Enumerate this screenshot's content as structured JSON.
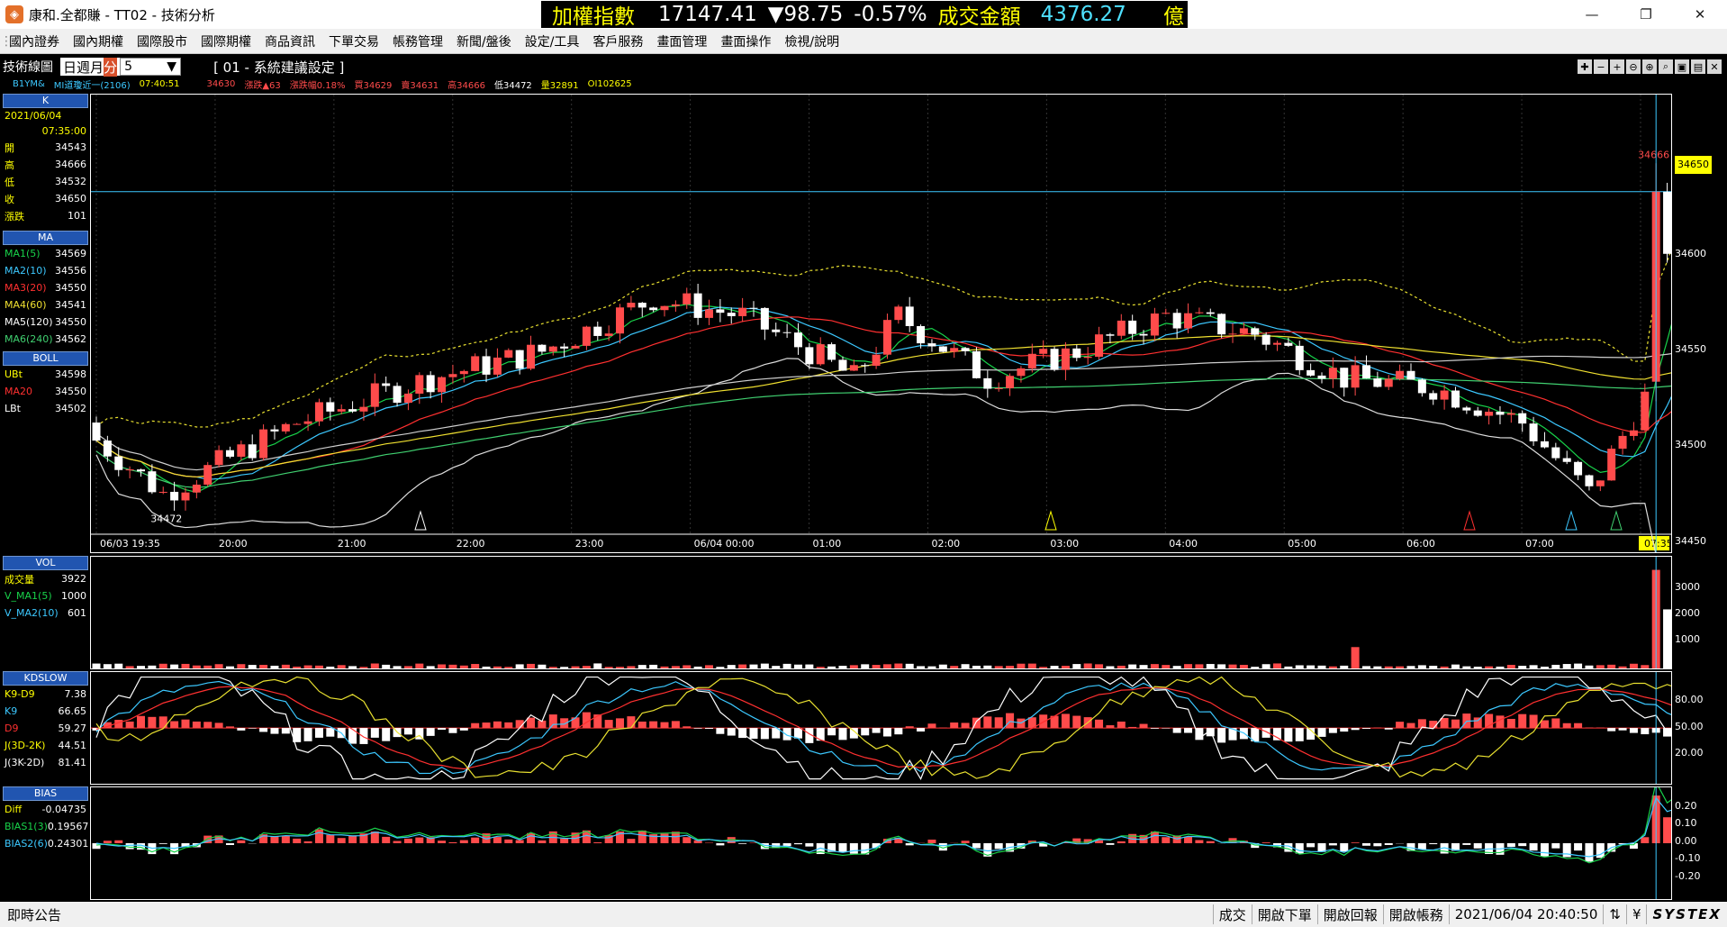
{
  "window": {
    "title": "康和.全都賺 - TT02 - 技術分析",
    "icon": "app-logo-icon",
    "buttons": [
      "—",
      "❐",
      "✕"
    ]
  },
  "ticker": {
    "label": "加權指數",
    "value": "17147.41",
    "change": "▼98.75",
    "pct": "-0.57%",
    "turnover_label": "成交金額",
    "turnover": "4376.27",
    "unit": "億"
  },
  "menu": [
    "國內證券",
    "國內期權",
    "國際股市",
    "國際期權",
    "商品資訊",
    "下單交易",
    "帳務管理",
    "新聞/盤後",
    "設定/工具",
    "客戶服務",
    "畫面管理",
    "畫面操作",
    "檢視/說明"
  ],
  "toolbar": {
    "panel_label": "技術線圖",
    "period": {
      "day": "日",
      "week": "週",
      "month": "月",
      "minute": "分"
    },
    "interval": "5",
    "setting": "[ 01 - 系統建議設定 ]"
  },
  "info": {
    "symbol": "B1YM&",
    "name": "MI道瓊近一(2106)",
    "time": "07:40:51",
    "last": "34630",
    "change": "漲跌▲63",
    "pct": "漲跌幅0.18%",
    "bid": "買34629",
    "ask": "賣34631",
    "high": "高34666",
    "low": "低34472",
    "vol": "量32891",
    "oi": "OI102625"
  },
  "k_panel": {
    "title": "K",
    "date": "2021/06/04",
    "time": "07:35:00",
    "rows": [
      {
        "label": "開",
        "value": "34543"
      },
      {
        "label": "高",
        "value": "34666"
      },
      {
        "label": "低",
        "value": "34532"
      },
      {
        "label": "收",
        "value": "34650"
      },
      {
        "label": "漲跌",
        "value": "101"
      }
    ]
  },
  "ma_panel": {
    "title": "MA",
    "rows": [
      {
        "label": "MA1(5)",
        "value": "34569"
      },
      {
        "label": "MA2(10)",
        "value": "34556"
      },
      {
        "label": "MA3(20)",
        "value": "34550"
      },
      {
        "label": "MA4(60)",
        "value": "34541"
      },
      {
        "label": "MA5(120)",
        "value": "34550"
      },
      {
        "label": "MA6(240)",
        "value": "34562"
      }
    ]
  },
  "boll_panel": {
    "title": "BOLL",
    "rows": [
      {
        "label": "UBt",
        "value": "34598"
      },
      {
        "label": "MA20",
        "value": "34550"
      },
      {
        "label": "LBt",
        "value": "34502"
      }
    ]
  },
  "vol_panel": {
    "title": "VOL",
    "rows": [
      {
        "label": "成交量",
        "value": "3922"
      },
      {
        "label": "V_MA1(5)",
        "value": "1000"
      },
      {
        "label": "V_MA2(10)",
        "value": "601"
      }
    ]
  },
  "kd_panel": {
    "title": "KDSLOW",
    "rows": [
      {
        "label": "K9-D9",
        "value": "7.38"
      },
      {
        "label": "K9",
        "value": "66.65"
      },
      {
        "label": "D9",
        "value": "59.27"
      },
      {
        "label": "J(3D-2K)",
        "value": "44.51"
      },
      {
        "label": "J(3K-2D)",
        "value": "81.41"
      }
    ]
  },
  "bias_panel": {
    "title": "BIAS",
    "rows": [
      {
        "label": "Diff",
        "value": "-0.04735"
      },
      {
        "label": "BIAS1(3)",
        "value": "0.19567"
      },
      {
        "label": "BIAS2(6)",
        "value": "0.24301"
      }
    ]
  },
  "colors": {
    "up": "#ff4b4b",
    "down": "#ffffff",
    "ma1": "#18d24a",
    "ma2": "#3cc8ff",
    "ma3": "#ff3030",
    "ma4": "#f0e030",
    "ma5": "#ffffff",
    "ma6": "#40d070",
    "panel_head": "#2155b0"
  },
  "chart_data": [
    {
      "type": "candlestick",
      "title": "K",
      "price_ticks": [
        "34650",
        "34600",
        "34550",
        "34500",
        "34450"
      ],
      "ylim": [
        34450,
        34700
      ],
      "time_labels": [
        "06/03 19:35",
        "20:00",
        "21:00",
        "22:00",
        "23:00",
        "06/04 00:00",
        "01:00",
        "02:00",
        "03:00",
        "04:00",
        "05:00",
        "06:00",
        "07:00",
        "07:35"
      ],
      "current_price": "34650",
      "annotations": [
        "34666",
        "34472"
      ],
      "last_bar": {
        "open": 34543,
        "high": 34666,
        "low": 34532,
        "close": 34650
      }
    },
    {
      "type": "bar",
      "title": "VOL",
      "ticks": [
        "3000",
        "2000",
        "1000"
      ],
      "last": 3922
    },
    {
      "type": "line",
      "title": "KDSLOW",
      "ticks": [
        "80.00",
        "50.00",
        "20.00"
      ]
    },
    {
      "type": "bar",
      "title": "BIAS",
      "ticks": [
        "0.20",
        "0.10",
        "0.00",
        "-0.10",
        "-0.20"
      ]
    }
  ],
  "status": {
    "left": "即時公告",
    "items": [
      "成交",
      "開啟下單",
      "開啟回報",
      "開啟帳務"
    ],
    "datetime": "2021/06/04 20:40:50",
    "brand": "SYSTEX"
  }
}
